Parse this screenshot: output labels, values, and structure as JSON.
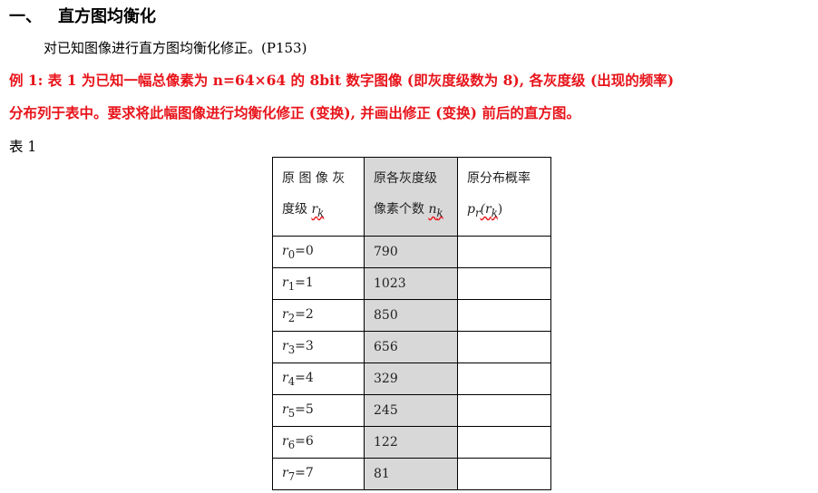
{
  "heading": {
    "number": "一、",
    "title": "直方图均衡化"
  },
  "intro": "对已知图像进行直方图均衡化修正。(P153)",
  "example": {
    "line1": "例 1: 表 1 为已知一幅总像素为 n=64×64 的 8bit 数字图像 (即灰度级数为 8), 各灰度级 (出现的频率)",
    "line2": "分布列于表中。要求将此幅图像进行均衡化修正 (变换), 并画出修正 (变换) 前后的直方图。"
  },
  "table_caption": "表 1",
  "table": {
    "headers": [
      {
        "line1": "原 图 像 灰",
        "line2_text": "度级 ",
        "line2_sym": "r",
        "line2_sub": "k"
      },
      {
        "line1": "原各灰度级",
        "line2_text": "像素个数 ",
        "line2_sym": "n",
        "line2_sub": "k"
      },
      {
        "line1": "原分布概率",
        "line2_text": "p",
        "line2_sub": "r",
        "line2_sym": "(r",
        "line2_sym_sub": "k",
        "line2_close": ")"
      }
    ],
    "rows": [
      {
        "level": "r",
        "sub": "0",
        "eq": "=0",
        "count": "790",
        "prob": ""
      },
      {
        "level": "r",
        "sub": "1",
        "eq": "=1",
        "count": "1023",
        "prob": ""
      },
      {
        "level": "r",
        "sub": "2",
        "eq": "=2",
        "count": "850",
        "prob": ""
      },
      {
        "level": "r",
        "sub": "3",
        "eq": "=3",
        "count": "656",
        "prob": ""
      },
      {
        "level": "r",
        "sub": "4",
        "eq": "=4",
        "count": "329",
        "prob": ""
      },
      {
        "level": "r",
        "sub": "5",
        "eq": "=5",
        "count": "245",
        "prob": ""
      },
      {
        "level": "r",
        "sub": "6",
        "eq": "=6",
        "count": "122",
        "prob": ""
      },
      {
        "level": "r",
        "sub": "7",
        "eq": "=7",
        "count": "81",
        "prob": ""
      }
    ]
  }
}
